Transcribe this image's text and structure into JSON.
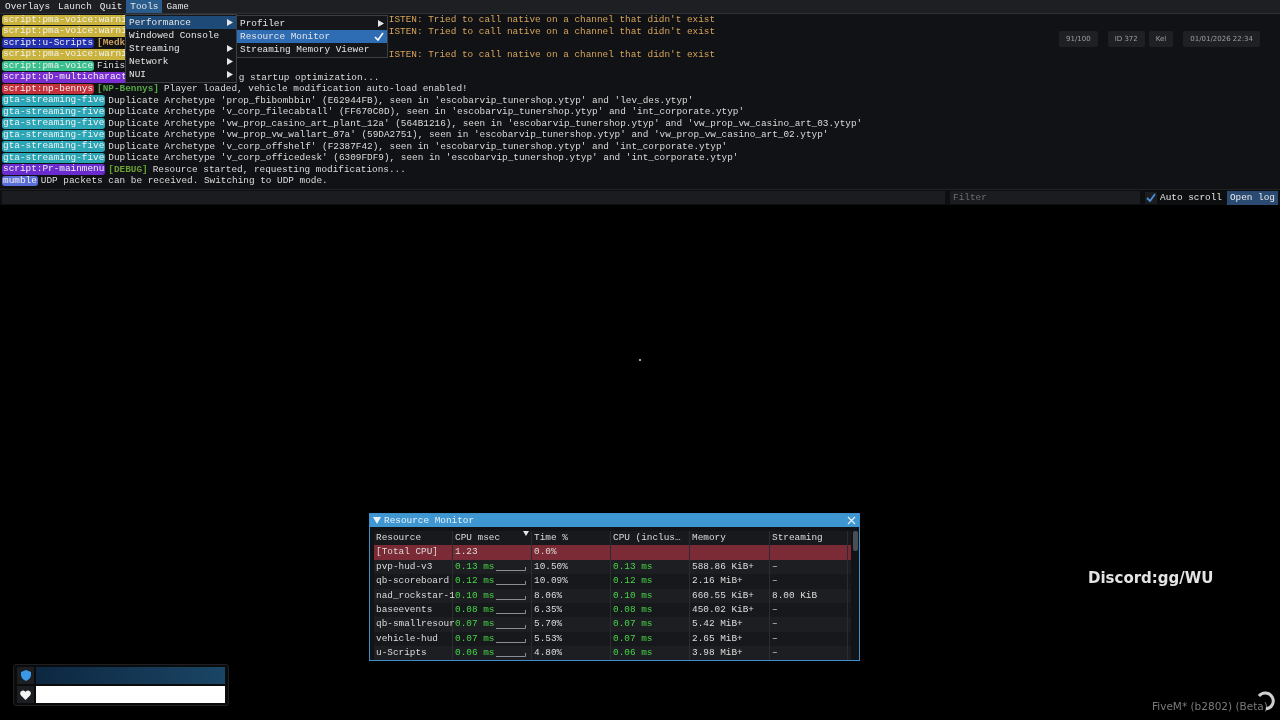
{
  "menu_bar": [
    {
      "label": "Overlays",
      "selected": false
    },
    {
      "label": "Launch",
      "selected": false
    },
    {
      "label": "Quit",
      "selected": false
    },
    {
      "label": "Tools",
      "selected": true
    },
    {
      "label": "Game",
      "selected": false
    }
  ],
  "tools_menu": [
    {
      "label": "Performance",
      "submenu": true,
      "selected": true
    },
    {
      "label": "Windowed Console",
      "submenu": false,
      "selected": false
    },
    {
      "label": "Streaming",
      "submenu": true,
      "selected": false
    },
    {
      "label": "Network",
      "submenu": true,
      "selected": false
    },
    {
      "label": "NUI",
      "submenu": true,
      "selected": false
    }
  ],
  "performance_menu": [
    {
      "label": "Profiler",
      "submenu": true,
      "selected": false,
      "checked": false
    },
    {
      "label": "Resource Monitor",
      "submenu": false,
      "selected": true,
      "checked": true
    },
    {
      "label": "Streaming Memory Viewer",
      "submenu": false,
      "selected": false,
      "checked": false
    }
  ],
  "console": {
    "lines": [
      {
        "tag": "script:pma-voice:warni",
        "color": "#c9b33c",
        "kind": "warning",
        "text": "ISTEN: Tried to call native on a channel that didn't exist"
      },
      {
        "tag": "script:pma-voice:warni",
        "color": "#c9b33c",
        "kind": "warning",
        "text": "ISTEN: Tried to call native on a channel that didn't exist"
      },
      {
        "tag": "script:u-Scripts",
        "color": "#2230b0",
        "kind": "info",
        "prefix": {
          "text": "[Medk"
        }
      },
      {
        "tag": "script:pma-voice:warni",
        "color": "#c9b33c",
        "kind": "warning",
        "text": "ISTEN: Tried to call native on a channel that didn't exist"
      },
      {
        "tag": "script:pma-voice",
        "color": "#38bf8c",
        "kind": "info",
        "text": "Finis"
      },
      {
        "tag": "script:qb-multicharact",
        "color": "#7a2ed2",
        "kind": "resumed",
        "text": "g startup optimization..."
      },
      {
        "tag": "script:np-bennys",
        "color": "#c4303c",
        "kind": "info",
        "prefix": {
          "text": "[NP-Bennys]",
          "color": "#58a848"
        },
        "text": "Player loaded, vehicle modification auto-load enabled!"
      },
      {
        "tag": "gta-streaming-five",
        "color": "#2aa6b6",
        "kind": "info",
        "text": "Duplicate Archetype 'prop_fbibombbin' (E62944FB), seen in 'escobarvip_tunershop.ytyp' and 'lev_des.ytyp'"
      },
      {
        "tag": "gta-streaming-five",
        "color": "#2aa6b6",
        "kind": "info",
        "text": "Duplicate Archetype 'v_corp_filecabtall' (FF670C0D), seen in 'escobarvip_tunershop.ytyp' and 'int_corporate.ytyp'"
      },
      {
        "tag": "gta-streaming-five",
        "color": "#2aa6b6",
        "kind": "info",
        "text": "Duplicate Archetype 'vw_prop_casino_art_plant_12a' (564B1216), seen in 'escobarvip_tunershop.ytyp' and 'vw_prop_vw_casino_art_03.ytyp'"
      },
      {
        "tag": "gta-streaming-five",
        "color": "#2aa6b6",
        "kind": "info",
        "text": "Duplicate Archetype 'vw_prop_vw_wallart_07a' (59DA2751), seen in 'escobarvip_tunershop.ytyp' and 'vw_prop_vw_casino_art_02.ytyp'"
      },
      {
        "tag": "gta-streaming-five",
        "color": "#2aa6b6",
        "kind": "info",
        "text": "Duplicate Archetype 'v_corp_offshelf' (F2387F42), seen in 'escobarvip_tunershop.ytyp' and 'int_corporate.ytyp'"
      },
      {
        "tag": "gta-streaming-five",
        "color": "#2aa6b6",
        "kind": "info",
        "text": "Duplicate Archetype 'v_corp_officedesk' (6309FDF9), seen in 'escobarvip_tunershop.ytyp' and 'int_corporate.ytyp'"
      },
      {
        "tag": "script:Pr-mainmenu",
        "color": "#6a2cce",
        "kind": "info",
        "prefix": {
          "text": "[DEBUG]",
          "color": "#6aa030"
        },
        "text": "Resource started, requesting modifications..."
      },
      {
        "tag": "mumble",
        "color": "#5a6ed8",
        "kind": "info",
        "text": "UDP packets can be received. Switching to UDP mode."
      }
    ],
    "filter": {
      "placeholder": "Filter"
    },
    "auto_scroll": {
      "label": "Auto scroll",
      "checked": true
    },
    "open_log": "Open log"
  },
  "game_hud": {
    "info": [
      "91/100",
      "ID 372",
      "Kel",
      "01/01/2026 22:34"
    ],
    "armor": {
      "level": 1
    },
    "health": {
      "level": 1
    },
    "discord": "Discord:gg/WU",
    "version": "FiveM* (b2802) (Beta)"
  },
  "resource_monitor": {
    "title": "Resource Monitor",
    "columns": [
      "Resource",
      "CPU msec",
      "Time %",
      "CPU (inclus…",
      "Memory",
      "Streaming"
    ],
    "rows": [
      {
        "kind": "total",
        "resource": "[Total CPU]",
        "cpu_msec": "1.23",
        "time_pct": "0.0%"
      },
      {
        "kind": "resource",
        "resource": "pvp-hud-v3",
        "cpu_msec": "0.13 ms",
        "time_pct": "10.50%",
        "cpu_inclusive": "0.13 ms",
        "memory": "588.86 KiB+",
        "streaming": "–"
      },
      {
        "kind": "resource",
        "resource": "qb-scoreboard",
        "cpu_msec": "0.12 ms",
        "time_pct": "10.09%",
        "cpu_inclusive": "0.12 ms",
        "memory": "2.16 MiB+",
        "streaming": "–"
      },
      {
        "kind": "resource",
        "resource": "nad_rockstar-1",
        "cpu_msec": "0.10 ms",
        "time_pct": "8.06%",
        "cpu_inclusive": "0.10 ms",
        "memory": "660.55 KiB+",
        "streaming": "8.00 KiB"
      },
      {
        "kind": "resource",
        "resource": "baseevents",
        "cpu_msec": "0.08 ms",
        "time_pct": "6.35%",
        "cpu_inclusive": "0.08 ms",
        "memory": "450.02 KiB+",
        "streaming": "–"
      },
      {
        "kind": "resource",
        "resource": "qb-smallresour",
        "cpu_msec": "0.07 ms",
        "time_pct": "5.70%",
        "cpu_inclusive": "0.07 ms",
        "memory": "5.42 MiB+",
        "streaming": "–"
      },
      {
        "kind": "resource",
        "resource": "vehicle-hud",
        "cpu_msec": "0.07 ms",
        "time_pct": "5.53%",
        "cpu_inclusive": "0.07 ms",
        "memory": "2.65 MiB+",
        "streaming": "–"
      },
      {
        "kind": "resource",
        "resource": "u-Scripts",
        "cpu_msec": "0.06 ms",
        "time_pct": "4.80%",
        "cpu_inclusive": "0.06 ms",
        "memory": "3.98 MiB+",
        "streaming": "–"
      }
    ]
  }
}
